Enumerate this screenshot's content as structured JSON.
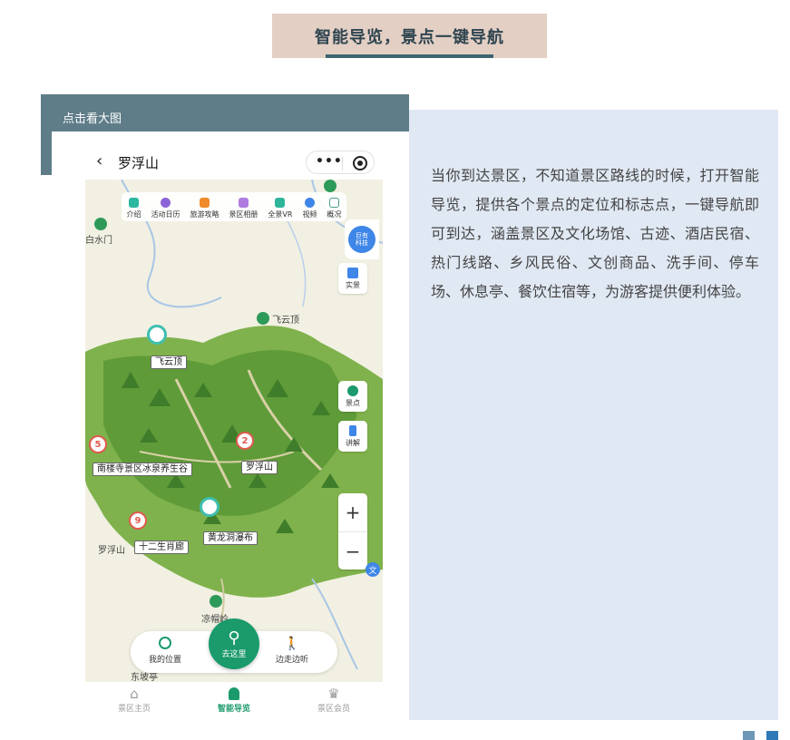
{
  "heading": "智能导览，景点一键导航",
  "band_label": "点击看大图",
  "description": "当你到达景区，不知道景区路线的时候，打开智能导览，提供各个景点的定位和标志点，一键导航即可到达，涵盖景区及文化场馆、古迹、酒店民宿、热门线路、乡风民俗、文创商品、洗手间、停车场、休息亭、餐饮住宿等，为游客提供便利体验。",
  "phone": {
    "back_glyph": "‹",
    "title": "罗浮山",
    "more_glyph": "•••",
    "toolbar": [
      {
        "label": "介绍",
        "icon": "intro-icon",
        "color": "#2bb7a0"
      },
      {
        "label": "活动日历",
        "icon": "calendar-icon",
        "color": "#8d63d8"
      },
      {
        "label": "旅游攻略",
        "icon": "guide-icon",
        "color": "#f08a2a"
      },
      {
        "label": "景区相册",
        "icon": "album-icon",
        "color": "#b07be0"
      },
      {
        "label": "全景VR",
        "icon": "vr-icon",
        "color": "#2fb59a"
      },
      {
        "label": "视频",
        "icon": "video-icon",
        "color": "#3e86e8"
      },
      {
        "label": "概况",
        "icon": "map-overview-icon",
        "color": "#4a9a8a"
      }
    ],
    "side_buttons": {
      "realscene": "实景",
      "spots": "景点",
      "explain": "讲解",
      "badge_line1": "巨有",
      "badge_line2": "科技"
    },
    "map_labels": {
      "baishuimen": "白水门",
      "feiyunding_peak": "飞云顶",
      "feiyunding": "飞云顶",
      "nanlousi": "南楼寺景区冰泉养生谷",
      "luofushan": "罗浮山",
      "huanglongdong": "黄龙洞瀑布",
      "shierxiao": "十二生肖廊",
      "luofushan_left": "罗浮山",
      "liangmaoling": "凉帽岭",
      "dongpo": "东坡亭",
      "wen": "文"
    },
    "pins": {
      "p5": "5",
      "p2": "2",
      "p9": "9"
    },
    "zoom": {
      "in": "+",
      "out": "−"
    },
    "bottom": {
      "my_location": "我的位置",
      "go_here": "去这里",
      "walk_listen": "边走边听"
    },
    "tabs": [
      {
        "label": "景区主页",
        "icon": "home-icon"
      },
      {
        "label": "智能导览",
        "icon": "guide-pin-icon"
      },
      {
        "label": "景区会员",
        "icon": "crown-icon"
      }
    ]
  },
  "colors": {
    "accent": "#1b9a6b",
    "band": "#5f7d89",
    "panel": "#e0e8f3",
    "title_bg": "#e3cfc4"
  }
}
